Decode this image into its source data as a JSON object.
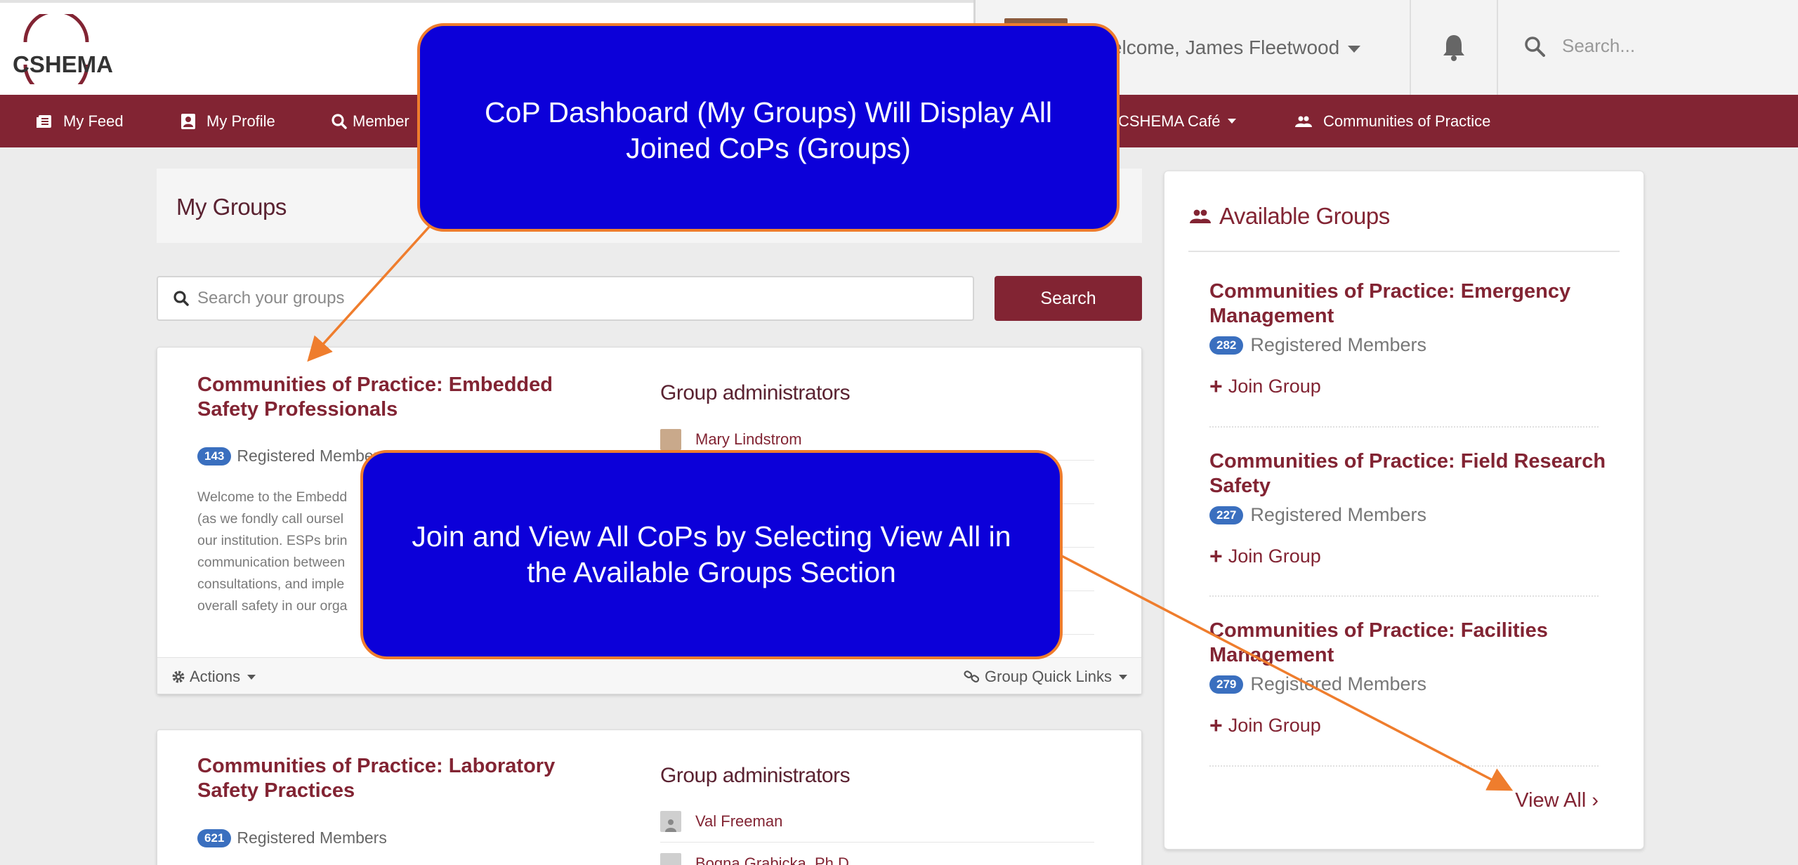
{
  "header": {
    "logo_text": "CSHEMA",
    "welcome": "Welcome, James Fleetwood",
    "search_placeholder": "Search..."
  },
  "nav": {
    "items": [
      {
        "label": "My Feed",
        "icon": "feed-icon"
      },
      {
        "label": "My Profile",
        "icon": "profile-icon"
      },
      {
        "label": "Member",
        "icon": "search-icon"
      },
      {
        "label": "CSHEMA Café",
        "icon": "cafe-icon"
      },
      {
        "label": "Communities of Practice",
        "icon": "group-icon"
      }
    ]
  },
  "my_groups": {
    "title": "My Groups",
    "search_placeholder": "Search your groups",
    "search_button": "Search",
    "cards": [
      {
        "title": "Communities of Practice: Embedded Safety Professionals",
        "members_count": "143",
        "members_label": "Registered Members",
        "description": [
          "Welcome to the Embedd",
          "(as we fondly call oursel",
          "our institution. ESPs brin",
          "communication between",
          "consultations, and imple",
          "overall safety in our orga"
        ],
        "admins_title": "Group administrators",
        "admins": [
          "Mary Lindstrom"
        ],
        "actions_label": "Actions",
        "quick_links_label": "Group Quick Links"
      },
      {
        "title": "Communities of Practice: Laboratory Safety Practices",
        "members_count": "621",
        "members_label": "Registered Members",
        "admins_title": "Group administrators",
        "admins": [
          "Val Freeman",
          "Bogna Grabicka, Ph.D."
        ]
      }
    ]
  },
  "available_groups": {
    "title": "Available Groups",
    "items": [
      {
        "name": "Communities of Practice: Emergency Management",
        "members_count": "282",
        "members_label": "Registered Members",
        "join_label": "Join Group"
      },
      {
        "name": "Communities of Practice: Field Research Safety",
        "members_count": "227",
        "members_label": "Registered Members",
        "join_label": "Join Group"
      },
      {
        "name": "Communities of Practice: Facilities Management",
        "members_count": "279",
        "members_label": "Registered Members",
        "join_label": "Join Group"
      }
    ],
    "view_all": "View All ›"
  },
  "callouts": {
    "top": "CoP Dashboard (My Groups) Will Display All Joined CoPs (Groups)",
    "middle": "Join and View All CoPs by Selecting View All in the Available Groups Section"
  },
  "colors": {
    "brand": "#822433",
    "callout_fill": "#0c00d9",
    "callout_border": "#ef7d2d",
    "badge": "#3a6fbf"
  }
}
